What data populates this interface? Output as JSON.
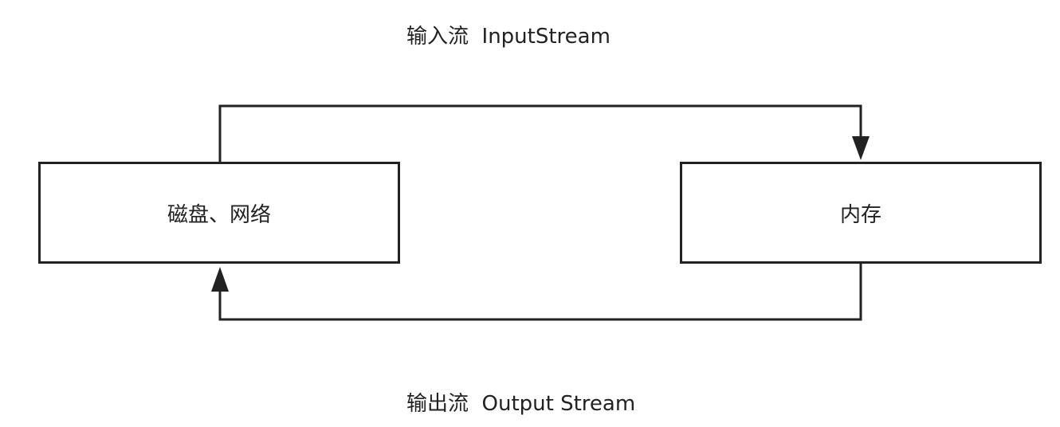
{
  "input_stream": {
    "label": "输入流  InputStream"
  },
  "output_stream": {
    "label": "输出流  Output Stream"
  },
  "nodes": {
    "disk_network": "磁盘、网络",
    "memory": "内存"
  },
  "colors": {
    "stroke": "#222222",
    "background": "#ffffff"
  }
}
